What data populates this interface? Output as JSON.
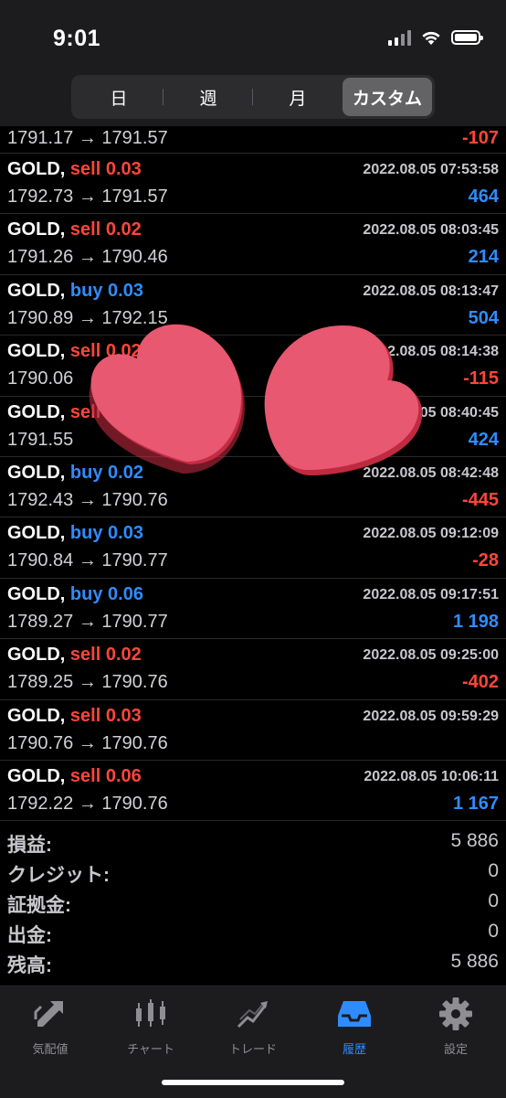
{
  "status": {
    "time": "9:01"
  },
  "segments": [
    {
      "label": "日",
      "active": false
    },
    {
      "label": "週",
      "active": false
    },
    {
      "label": "月",
      "active": false
    },
    {
      "label": "カスタム",
      "active": true
    }
  ],
  "partial_row": {
    "prices": "1791.17 → 1791.57",
    "profit": "-107"
  },
  "trades": [
    {
      "symbol": "GOLD,",
      "side": "sell",
      "volume": "0.03",
      "date": "2022.08.05 07:53:58",
      "prices": "1792.73 → 1791.57",
      "profit": "464"
    },
    {
      "symbol": "GOLD,",
      "side": "sell",
      "volume": "0.02",
      "date": "2022.08.05 08:03:45",
      "prices": "1791.26 → 1790.46",
      "profit": "214"
    },
    {
      "symbol": "GOLD,",
      "side": "buy",
      "volume": "0.03",
      "date": "2022.08.05 08:13:47",
      "prices": "1790.89 → 1792.15",
      "profit": "504"
    },
    {
      "symbol": "GOLD,",
      "side": "sell",
      "volume": "0.02",
      "date": "2022.08.05 08:14:38",
      "prices": "1790.06",
      "profit": "-115"
    },
    {
      "symbol": "GOLD,",
      "side": "sell",
      "volume": "",
      "date": "05 08:40:45",
      "prices": "1791.55",
      "profit": "424"
    },
    {
      "symbol": "GOLD,",
      "side": "buy",
      "volume": "0.02",
      "date": "2022.08.05 08:42:48",
      "prices": "1792.43 → 1790.76",
      "profit": "-445"
    },
    {
      "symbol": "GOLD,",
      "side": "buy",
      "volume": "0.03",
      "date": "2022.08.05 09:12:09",
      "prices": "1790.84 → 1790.77",
      "profit": "-28"
    },
    {
      "symbol": "GOLD,",
      "side": "buy",
      "volume": "0.06",
      "date": "2022.08.05 09:17:51",
      "prices": "1789.27 → 1790.77",
      "profit": "1 198"
    },
    {
      "symbol": "GOLD,",
      "side": "sell",
      "volume": "0.02",
      "date": "2022.08.05 09:25:00",
      "prices": "1789.25 → 1790.76",
      "profit": "-402"
    },
    {
      "symbol": "GOLD,",
      "side": "sell",
      "volume": "0.03",
      "date": "2022.08.05 09:59:29",
      "prices": "1790.76 → 1790.76",
      "profit": ""
    },
    {
      "symbol": "GOLD,",
      "side": "sell",
      "volume": "0.06",
      "date": "2022.08.05 10:06:11",
      "prices": "1792.22 → 1790.76",
      "profit": "1 167"
    }
  ],
  "summary": [
    {
      "label": "損益:",
      "value": "5 886"
    },
    {
      "label": "クレジット:",
      "value": "0"
    },
    {
      "label": "証拠金:",
      "value": "0"
    },
    {
      "label": "出金:",
      "value": "0"
    },
    {
      "label": "残高:",
      "value": "5 886"
    }
  ],
  "tabs": [
    {
      "label": "気配値",
      "icon": "quotes-arrows-icon",
      "active": false
    },
    {
      "label": "チャート",
      "icon": "candlestick-chart-icon",
      "active": false
    },
    {
      "label": "トレード",
      "icon": "trade-chart-icon",
      "active": false
    },
    {
      "label": "履歴",
      "icon": "history-inbox-icon",
      "active": true
    },
    {
      "label": "設定",
      "icon": "gear-icon",
      "active": false
    }
  ],
  "colors": {
    "sell": "#ff453a",
    "buy": "#2f8cff",
    "negative": "#ff453a",
    "positive": "#2f8cff",
    "active_tab": "#2f8cff",
    "heart": "#e85870"
  }
}
